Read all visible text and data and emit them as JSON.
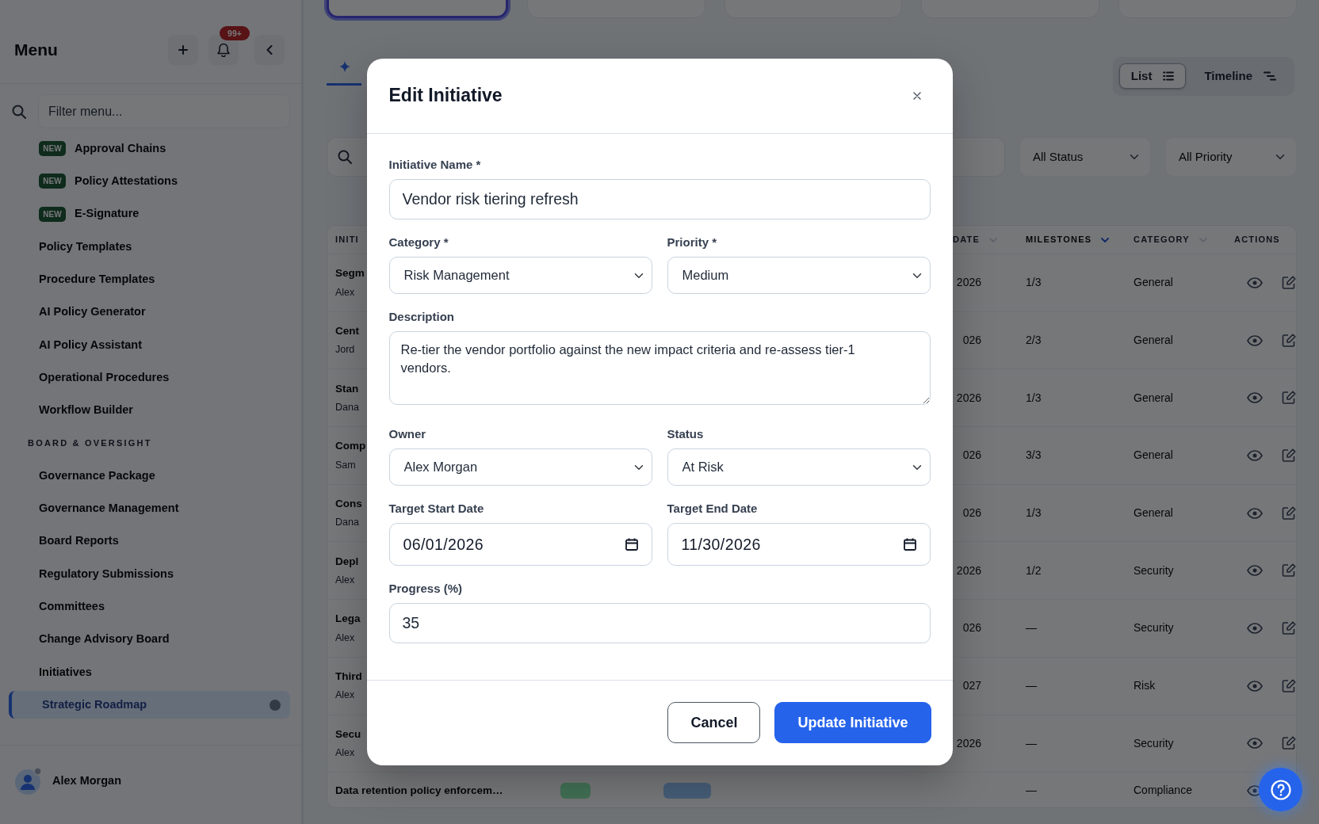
{
  "sidebar": {
    "title": "Menu",
    "notifications": "99+",
    "filter": {
      "placeholder": "Filter menu..."
    },
    "sections": [
      {
        "items": [
          {
            "label": "Approval Chains",
            "badge": "NEW",
            "selected": false
          },
          {
            "label": "Policy Attestations",
            "badge": "NEW",
            "selected": false
          },
          {
            "label": "E-Signature",
            "badge": "NEW",
            "selected": false
          },
          {
            "label": "Policy Templates",
            "selected": false
          },
          {
            "label": "Procedure Templates",
            "selected": false
          },
          {
            "label": "AI Policy Generator",
            "selected": false
          },
          {
            "label": "AI Policy Assistant",
            "selected": false
          },
          {
            "label": "Operational Procedures",
            "selected": false
          },
          {
            "label": "Workflow Builder",
            "selected": false
          }
        ]
      },
      {
        "heading": "BOARD & OVERSIGHT",
        "items": [
          {
            "label": "Governance Package",
            "selected": false
          },
          {
            "label": "Governance Management",
            "selected": false
          },
          {
            "label": "Board Reports",
            "selected": false
          },
          {
            "label": "Regulatory Submissions",
            "selected": false
          },
          {
            "label": "Committees",
            "selected": false
          },
          {
            "label": "Change Advisory Board",
            "selected": false
          },
          {
            "label": "Initiatives",
            "selected": false
          },
          {
            "label": "Strategic Roadmap",
            "selected": true
          }
        ]
      }
    ],
    "user": {
      "name": "Alex Morgan"
    }
  },
  "summary_cards": [
    {
      "selected": true
    },
    {
      "selected": false
    },
    {
      "selected": false
    },
    {
      "selected": false
    },
    {
      "selected": false
    }
  ],
  "view_tabs": [
    {
      "selected": true
    }
  ],
  "view_toggle": [
    {
      "kind": "list",
      "label": "List",
      "selected": true
    },
    {
      "kind": "timeline",
      "label": "Timeline",
      "selected": false
    }
  ],
  "filters": [
    {
      "value": "All Status"
    },
    {
      "value": "All Priority"
    }
  ],
  "table": {
    "columns": [
      {
        "kind": "title",
        "label": "INITI"
      },
      {
        "kind": "end_date",
        "label": "DATE",
        "sorted": false
      },
      {
        "kind": "milestones",
        "label": "MILESTONES",
        "sorted": true
      },
      {
        "kind": "category",
        "label": "CATEGORY",
        "sorted": false
      },
      {
        "kind": "actions",
        "label": "ACTIONS"
      }
    ],
    "rows": [
      {
        "title": "Segm",
        "owner": "Alex",
        "end_date": "2026",
        "milestones": "1/3",
        "category": "General",
        "actions": [
          {
            "kind": "view"
          },
          {
            "kind": "edit"
          }
        ]
      },
      {
        "title": "Cent",
        "owner": "Jord",
        "end_date": "026",
        "milestones": "2/3",
        "category": "General",
        "actions": [
          {
            "kind": "view"
          },
          {
            "kind": "edit"
          }
        ]
      },
      {
        "title": "Stan",
        "owner": "Dana",
        "end_date": "2026",
        "milestones": "1/3",
        "category": "General",
        "actions": [
          {
            "kind": "view"
          },
          {
            "kind": "edit"
          }
        ]
      },
      {
        "title": "Comp",
        "owner": "Sam",
        "end_date": "026",
        "milestones": "3/3",
        "category": "General",
        "actions": [
          {
            "kind": "view"
          },
          {
            "kind": "edit"
          }
        ]
      },
      {
        "title": "Cons",
        "owner": "Dana",
        "end_date": "026",
        "milestones": "1/3",
        "category": "General",
        "actions": [
          {
            "kind": "view"
          },
          {
            "kind": "edit"
          }
        ]
      },
      {
        "title": "Depl",
        "owner": "Alex",
        "end_date": "2026",
        "milestones": "1/2",
        "category": "Security",
        "actions": [
          {
            "kind": "view"
          },
          {
            "kind": "edit"
          }
        ]
      },
      {
        "title": "Lega",
        "owner": "Alex",
        "end_date": "026",
        "milestones": "—",
        "category": "Security",
        "actions": [
          {
            "kind": "view"
          },
          {
            "kind": "edit"
          }
        ]
      },
      {
        "title": "Third",
        "owner": "Alex",
        "end_date": "027",
        "milestones": "—",
        "category": "Risk",
        "actions": [
          {
            "kind": "view"
          },
          {
            "kind": "edit"
          }
        ]
      },
      {
        "title": "Secu",
        "owner": "Alex",
        "end_date": "2026",
        "milestones": "—",
        "category": "Security",
        "actions": [
          {
            "kind": "view"
          },
          {
            "kind": "edit"
          }
        ]
      },
      {
        "title": "Data retention policy enforcem…",
        "tags": [
          {
            "kind": "priority"
          },
          {
            "kind": "status"
          }
        ],
        "milestones": "—",
        "category": "Compliance",
        "actions": [
          {
            "kind": "view"
          }
        ]
      }
    ]
  },
  "modal": {
    "title": "Edit Initiative",
    "rows": [
      [
        {
          "kind": "text",
          "label": "Initiative Name *",
          "value": "Vendor risk tiering refresh"
        }
      ],
      [
        {
          "kind": "select",
          "label": "Category *",
          "value": "Risk Management"
        },
        {
          "kind": "select",
          "label": "Priority *",
          "value": "Medium"
        }
      ],
      [
        {
          "kind": "textarea",
          "label": "Description",
          "value": "Re-tier the vendor portfolio against the new impact criteria and re-assess tier-1 vendors."
        }
      ],
      [
        {
          "kind": "select",
          "label": "Owner",
          "value": "Alex Morgan"
        },
        {
          "kind": "select",
          "label": "Status",
          "value": "At Risk"
        }
      ],
      [
        {
          "kind": "date",
          "label": "Target Start Date",
          "value": "06/01/2026"
        },
        {
          "kind": "date",
          "label": "Target End Date",
          "value": "11/30/2026"
        }
      ],
      [
        {
          "kind": "number",
          "label": "Progress (%)",
          "value": "35"
        }
      ]
    ],
    "buttons": [
      {
        "kind": "secondary",
        "label": "Cancel"
      },
      {
        "kind": "primary",
        "label": "Update Initiative"
      }
    ]
  }
}
